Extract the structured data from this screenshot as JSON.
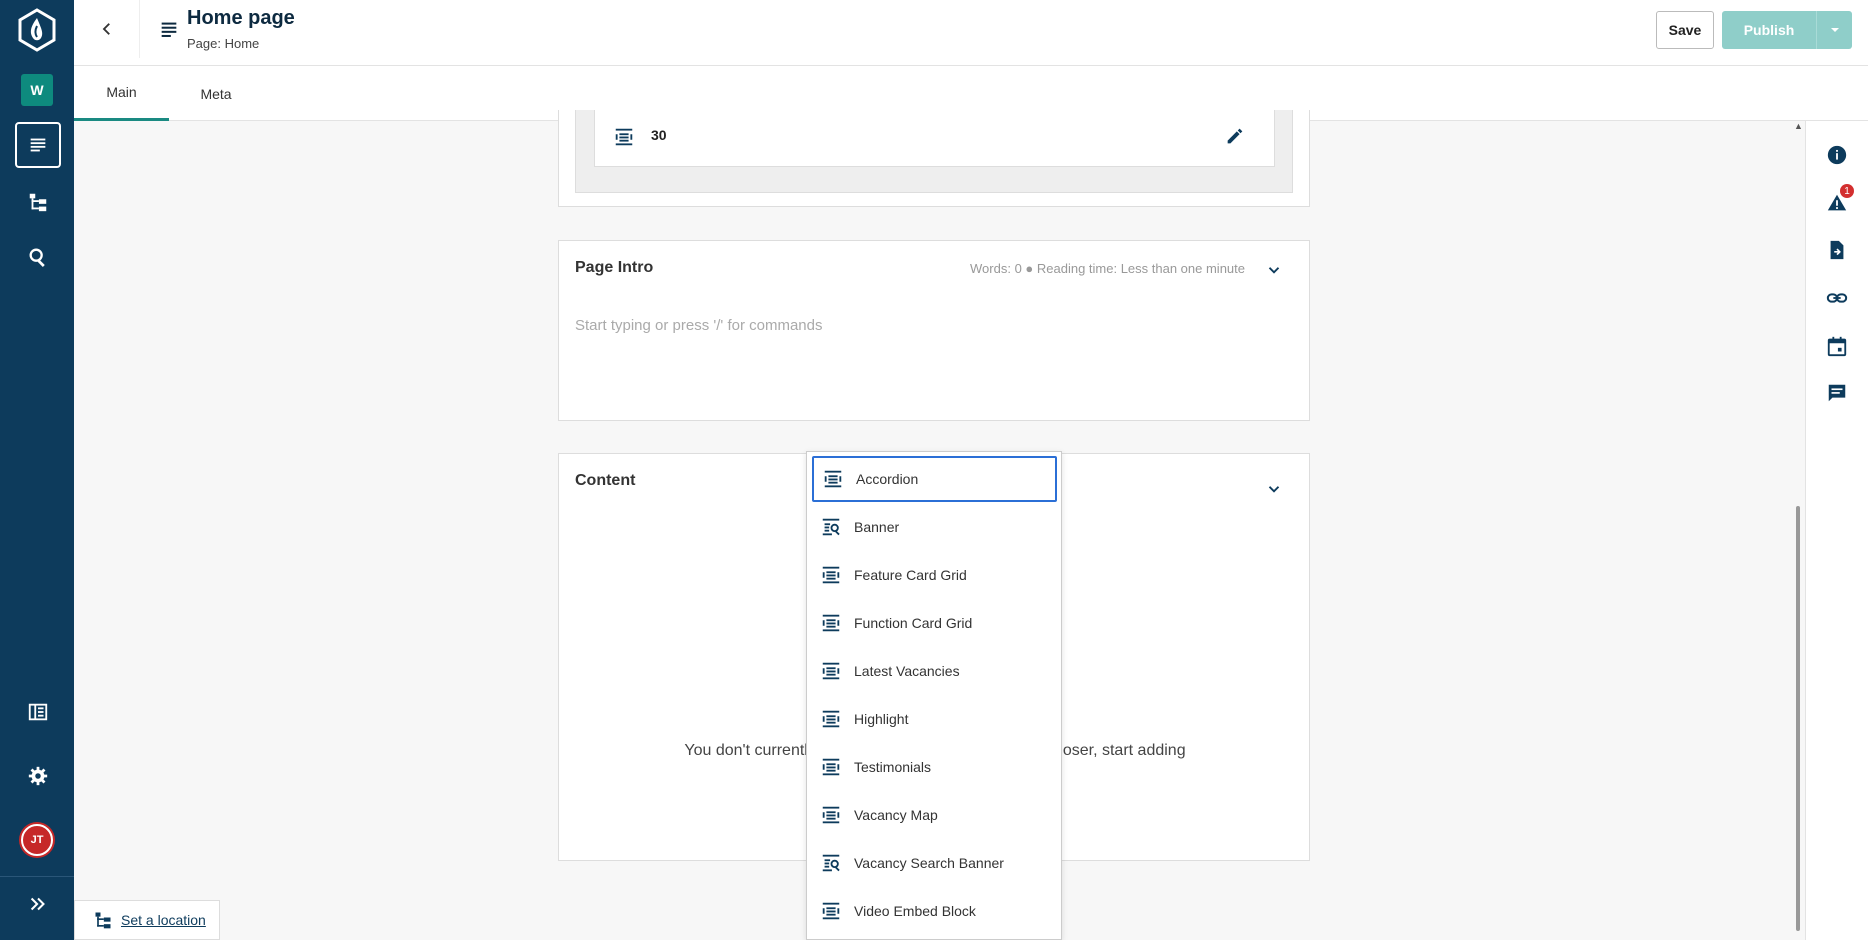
{
  "app": {
    "workspace_initial": "W",
    "user_initials": "JT"
  },
  "header": {
    "title": "Home page",
    "subtitle": "Page: Home",
    "save_label": "Save",
    "publish_label": "Publish"
  },
  "tabs": [
    {
      "label": "Main",
      "active": true
    },
    {
      "label": "Meta",
      "active": false
    }
  ],
  "nested_item": {
    "value": "30"
  },
  "page_intro": {
    "title": "Page Intro",
    "word_count": "Words: 0 ● Reading time: Less than one minute",
    "placeholder": "Start typing or press '/' for commands"
  },
  "content": {
    "title": "Content",
    "empty_message_left": "You don't currentl",
    "empty_message_right": "oser, start adding"
  },
  "component_menu": {
    "items": [
      {
        "label": "Accordion",
        "icon": "component-icon",
        "selected": true
      },
      {
        "label": "Banner",
        "icon": "search-component-icon"
      },
      {
        "label": "Feature Card Grid",
        "icon": "component-icon"
      },
      {
        "label": "Function Card Grid",
        "icon": "component-icon"
      },
      {
        "label": "Latest Vacancies",
        "icon": "component-icon"
      },
      {
        "label": "Highlight",
        "icon": "component-icon"
      },
      {
        "label": "Testimonials",
        "icon": "component-icon"
      },
      {
        "label": "Vacancy Map",
        "icon": "component-icon"
      },
      {
        "label": "Vacancy Search Banner",
        "icon": "search-component-icon"
      },
      {
        "label": "Video Embed Block",
        "icon": "component-icon"
      }
    ]
  },
  "right_rail": {
    "alert_count": "1"
  },
  "location": {
    "label": "Set a location"
  },
  "colors": {
    "rail": "#0d3b5c",
    "accent": "#1a8a82",
    "publish": "#8fcec9",
    "selected_outline": "#2b6fd6"
  }
}
